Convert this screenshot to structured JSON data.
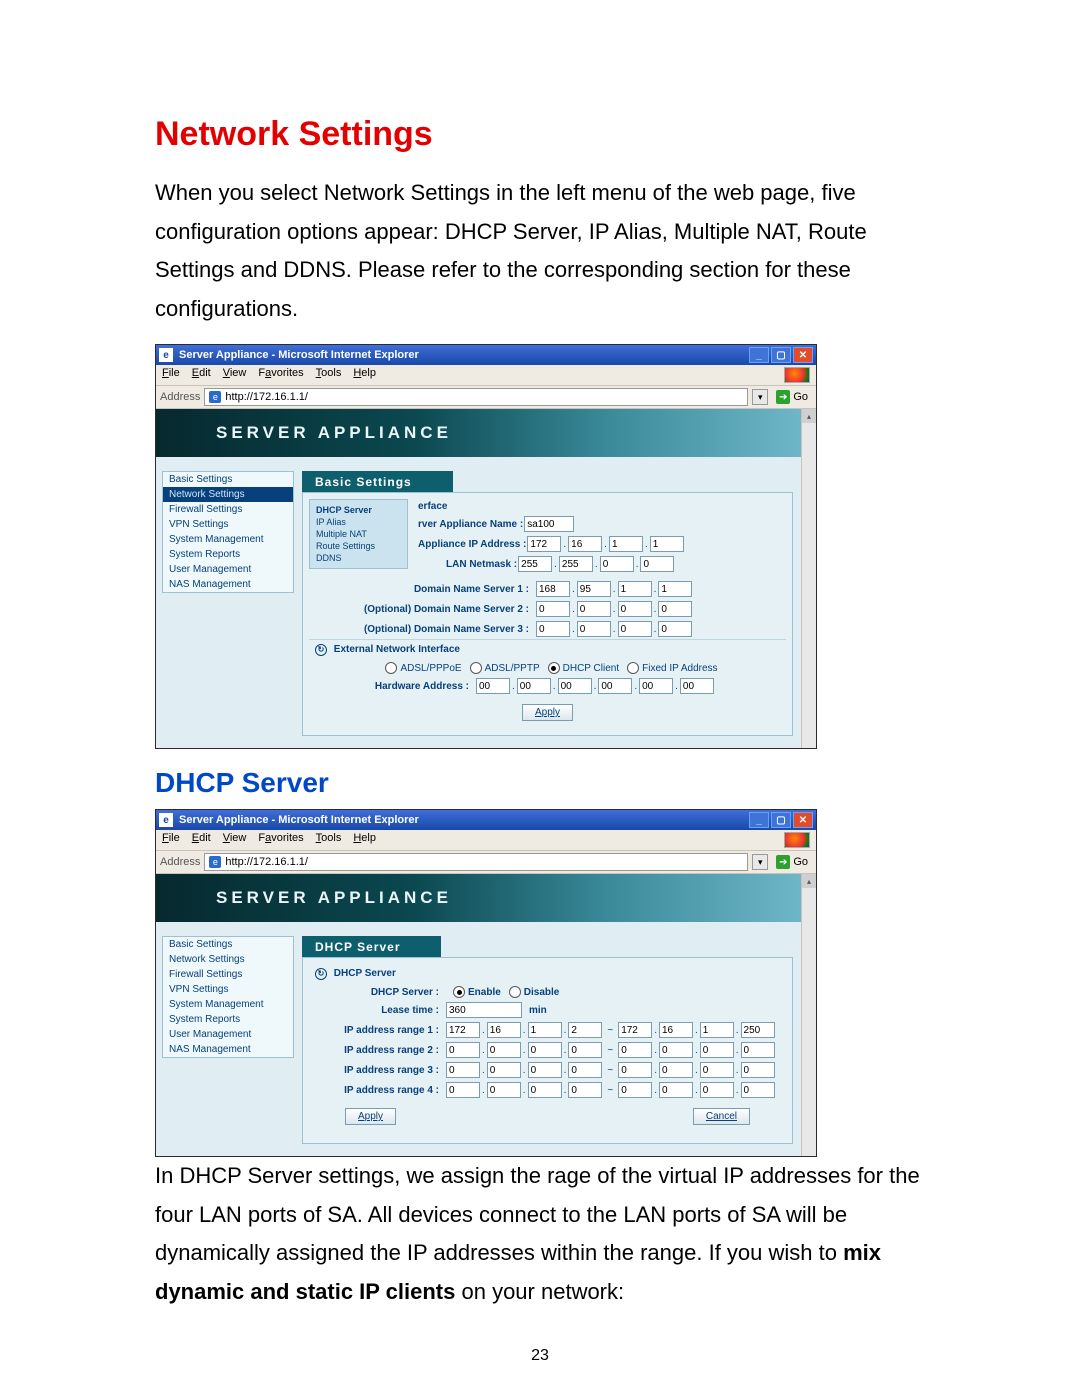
{
  "heading1": "Network Settings",
  "intro": "When you select Network Settings in the left menu of the web page, five configuration options appear: DHCP Server, IP Alias, Multiple NAT, Route Settings and DDNS. Please refer to the corresponding section for these configurations.",
  "heading2": "DHCP Server",
  "outro_pre": "In DHCP Server settings, we assign the rage of the virtual IP addresses for the four LAN ports of SA. All devices connect to the LAN ports of SA will be dynamically assigned the IP addresses within the range. If you wish to ",
  "outro_bold": "mix dynamic and static IP clients",
  "outro_post": " on your network:",
  "page_number": "23",
  "browser": {
    "title": "Server Appliance - Microsoft Internet Explorer",
    "menu": {
      "file": "File",
      "edit": "Edit",
      "view": "View",
      "favorites": "Favorites",
      "tools": "Tools",
      "help": "Help"
    },
    "addr_label": "Address",
    "url": "http://172.16.1.1/",
    "go": "Go",
    "banner": "SERVER APPLIANCE",
    "sidebar": [
      "Basic Settings",
      "Network Settings",
      "Firewall Settings",
      "VPN Settings",
      "System Management",
      "System Reports",
      "User Management",
      "NAS Management"
    ]
  },
  "shot1": {
    "tab": "Basic Settings",
    "submenu": [
      "DHCP Server",
      "IP Alias",
      "Multiple NAT",
      "Route Settings",
      "DDNS"
    ],
    "section_iface": "erface",
    "appliance_name_label": "rver Appliance Name :",
    "appliance_name": "sa100",
    "appliance_ip_label": "Appliance IP Address :",
    "appliance_ip": [
      "172",
      "16",
      "1",
      "1"
    ],
    "lan_netmask_label": "LAN Netmask :",
    "lan_netmask": [
      "255",
      "255",
      "0",
      "0"
    ],
    "dns1_label": "Domain Name Server 1 :",
    "dns1": [
      "168",
      "95",
      "1",
      "1"
    ],
    "dns2_label": "(Optional) Domain Name Server 2 :",
    "dns2": [
      "0",
      "0",
      "0",
      "0"
    ],
    "dns3_label": "(Optional) Domain Name Server 3 :",
    "dns3": [
      "0",
      "0",
      "0",
      "0"
    ],
    "ext_head": "External Network Interface",
    "radios": [
      "ADSL/PPPoE",
      "ADSL/PPTP",
      "DHCP Client",
      "Fixed IP Address"
    ],
    "hw_label": "Hardware Address :",
    "hw": [
      "00",
      "00",
      "00",
      "00",
      "00",
      "00"
    ],
    "apply": "Apply"
  },
  "shot2": {
    "tab": "DHCP Server",
    "section": "DHCP Server",
    "enable_label": "DHCP Server :",
    "enable": "Enable",
    "disable": "Disable",
    "lease_label": "Lease time :",
    "lease": "360",
    "lease_unit": "min",
    "range_labels": [
      "IP address range 1 :",
      "IP address range 2 :",
      "IP address range 3 :",
      "IP address range 4 :"
    ],
    "range1_from": [
      "172",
      "16",
      "1",
      "2"
    ],
    "range1_to": [
      "172",
      "16",
      "1",
      "250"
    ],
    "range_zero": [
      "0",
      "0",
      "0",
      "0"
    ],
    "apply": "Apply",
    "cancel": "Cancel"
  }
}
